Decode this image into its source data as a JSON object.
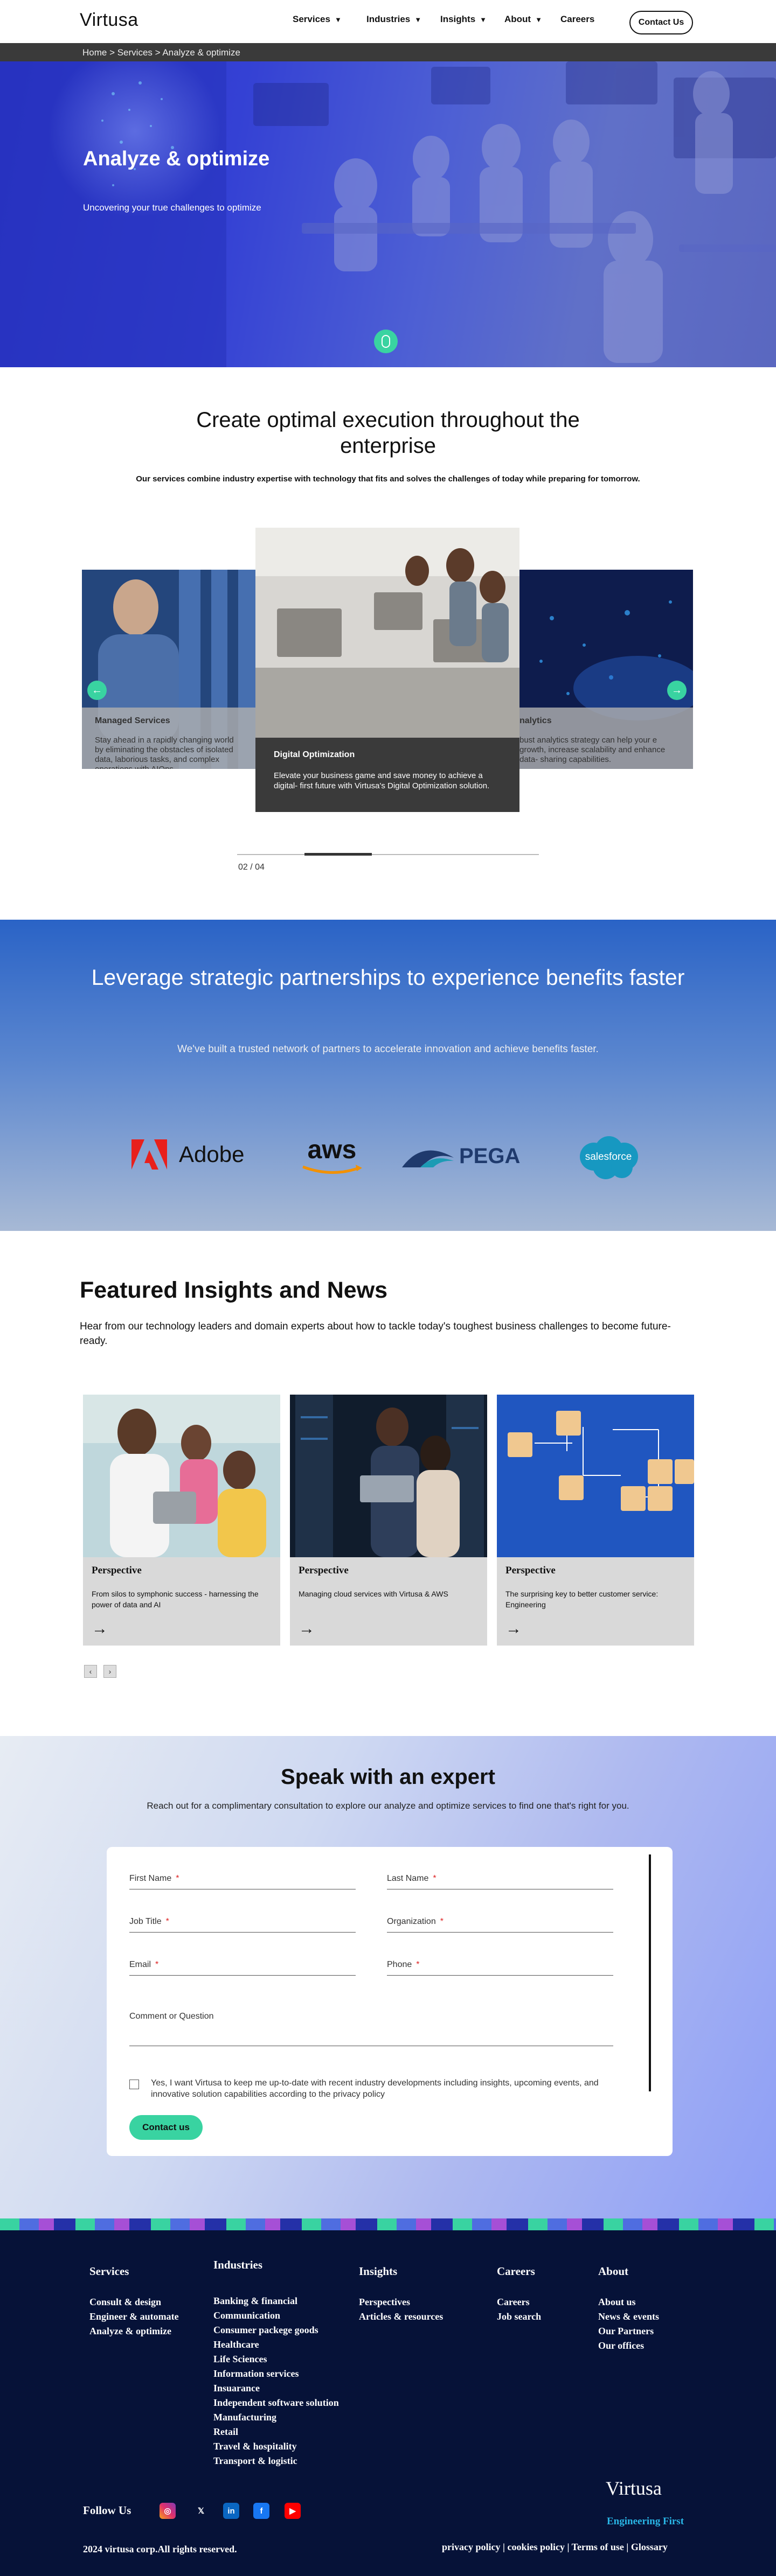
{
  "header": {
    "logo": "Virtusa",
    "nav": [
      {
        "label": "Services",
        "has_dropdown": true
      },
      {
        "label": "Industries",
        "has_dropdown": true
      },
      {
        "label": "Insights",
        "has_dropdown": true
      },
      {
        "label": "About",
        "has_dropdown": true
      },
      {
        "label": "Careers",
        "has_dropdown": false
      }
    ],
    "contact_label": "Contact Us",
    "breadcrumb": "Home > Services > Analyze & optimize"
  },
  "hero": {
    "title": "Analyze & optimize",
    "subtitle": "Uncovering your true challenges to optimize"
  },
  "execution": {
    "title": "Create optimal execution throughout the enterprise",
    "description": "Our services combine industry expertise with technology that fits and solves the challenges of today while preparing for tomorrow.",
    "cards": [
      {
        "title": "Managed Services",
        "text": "Stay ahead in a rapidly changing world by eliminating the obstacles of isolated data, laborious tasks, and complex operations with AIOps."
      },
      {
        "title": "Digital Optimization",
        "text": "Elevate your business game and save money to achieve a digital- first future with Virtusa's Digital Optimization solution."
      },
      {
        "title": "nalytics",
        "text": "bust analytics strategy can help your e growth, increase scalability and enhance data- sharing capabilities."
      }
    ],
    "counter": "02 / 04",
    "progress": 0.5
  },
  "partners": {
    "title": "Leverage strategic partnerships to experience benefits faster",
    "description": "We've built a trusted network of partners to accelerate innovation and achieve benefits faster.",
    "logos": [
      "Adobe",
      "aws",
      "PEGA",
      "salesforce"
    ]
  },
  "insights": {
    "title": "Featured Insights and News",
    "description": "Hear from our technology leaders and domain experts about how to tackle today's toughest business challenges to become future-ready.",
    "cards": [
      {
        "type": "Perspective",
        "text": "From silos to symphonic success - harnessing the power of data and AI"
      },
      {
        "type": "Perspective",
        "text": "Managing cloud services with Virtusa & AWS"
      },
      {
        "type": "Perspective",
        "text": "The surprising key to better customer service: Engineering"
      }
    ]
  },
  "expert": {
    "title": "Speak with an expert",
    "description": "Reach out for a complimentary consultation to explore our analyze and optimize services to find one that's right for you.",
    "fields": {
      "first_name": "First Name",
      "last_name": "Last Name",
      "job_title": "Job Title",
      "organization": "Organization",
      "email": "Email",
      "phone": "Phone",
      "comment": "Comment or Question"
    },
    "required_mark": "*",
    "consent": "Yes, I want Virtusa to keep me up-to-date with recent industry developments including insights, upcoming events, and innovative solution capabilities according to the privacy policy",
    "submit_label": "Contact us"
  },
  "footer": {
    "columns": [
      {
        "heading": "Services",
        "items": [
          "Consult & design",
          "Engineer & automate",
          "Analyze & optimize"
        ]
      },
      {
        "heading": "Industries",
        "items": [
          "Banking & financial",
          "Communication",
          "Consumer packege goods",
          "Healthcare",
          "Life Sciences",
          "Information services",
          "Insuarance",
          "Independent software solution",
          "Manufacturing",
          "Retail",
          "Travel & hospitality",
          "Transport & logistic"
        ]
      },
      {
        "heading": "Insights",
        "items": [
          "Perspectives",
          "Articles & resources"
        ]
      },
      {
        "heading": "Careers",
        "items": [
          "Careers",
          "Job search"
        ]
      },
      {
        "heading": "About",
        "items": [
          "About us",
          "News & events",
          "Our Partners",
          "Our offices"
        ]
      }
    ],
    "follow_label": "Follow Us",
    "social": [
      "instagram-icon",
      "x-icon",
      "linkedin-icon",
      "facebook-icon",
      "youtube-icon"
    ],
    "logo": "Virtusa",
    "tagline": "Engineering First",
    "copyright": "2024 virtusa corp.All rights reserved.",
    "legal": "privacy policy | cookies policy | Terms of use | Glossary"
  }
}
